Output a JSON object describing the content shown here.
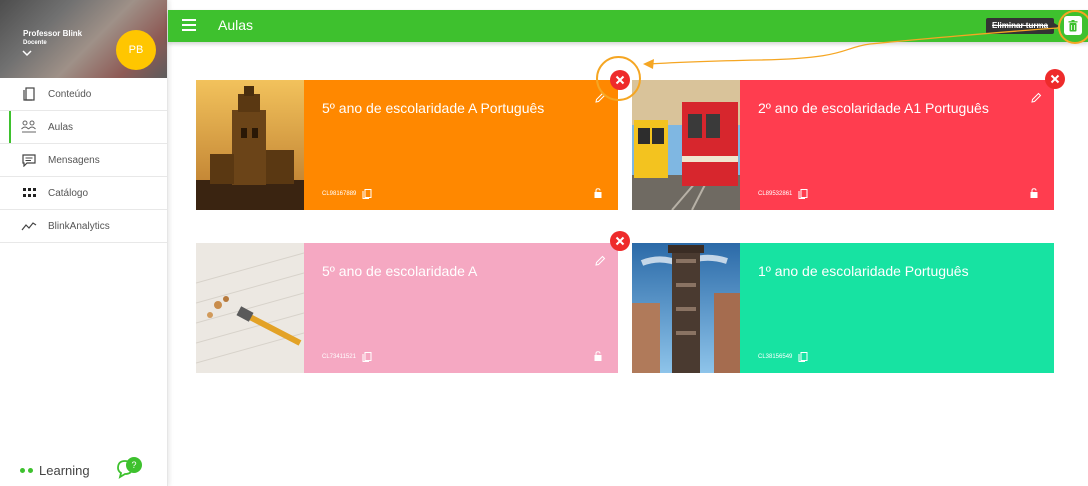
{
  "profile": {
    "name": "Professor Blink",
    "role": "Docente",
    "initials": "PB"
  },
  "sidebar": {
    "items": [
      {
        "label": "Conteúdo"
      },
      {
        "label": "Aulas"
      },
      {
        "label": "Mensagens"
      },
      {
        "label": "Catálogo"
      },
      {
        "label": "BlinkAnalytics"
      }
    ],
    "footer": {
      "label": "Learning",
      "badge": "?"
    }
  },
  "header": {
    "title": "Aulas",
    "delete_tooltip": "Eliminar turma"
  },
  "colors": {
    "accent": "#3ec12e",
    "highlight": "#f5a623",
    "delete": "#ee2b2b"
  },
  "cards": [
    {
      "title": "5º ano de escolaridade A Português",
      "code": "CL98167889",
      "color": "#ff8800",
      "image": "tower"
    },
    {
      "title": "2º ano de escolaridade A1 Português",
      "code": "CL89532861",
      "color": "#ff3d4f",
      "image": "tram"
    },
    {
      "title": "5º ano de escolaridade A",
      "code": "CL73411521",
      "color": "#f5a8c2",
      "image": "pencil"
    },
    {
      "title": "1º ano de escolaridade  Português",
      "code": "CL38156549",
      "color": "#17e3a2",
      "image": "elevator"
    }
  ]
}
